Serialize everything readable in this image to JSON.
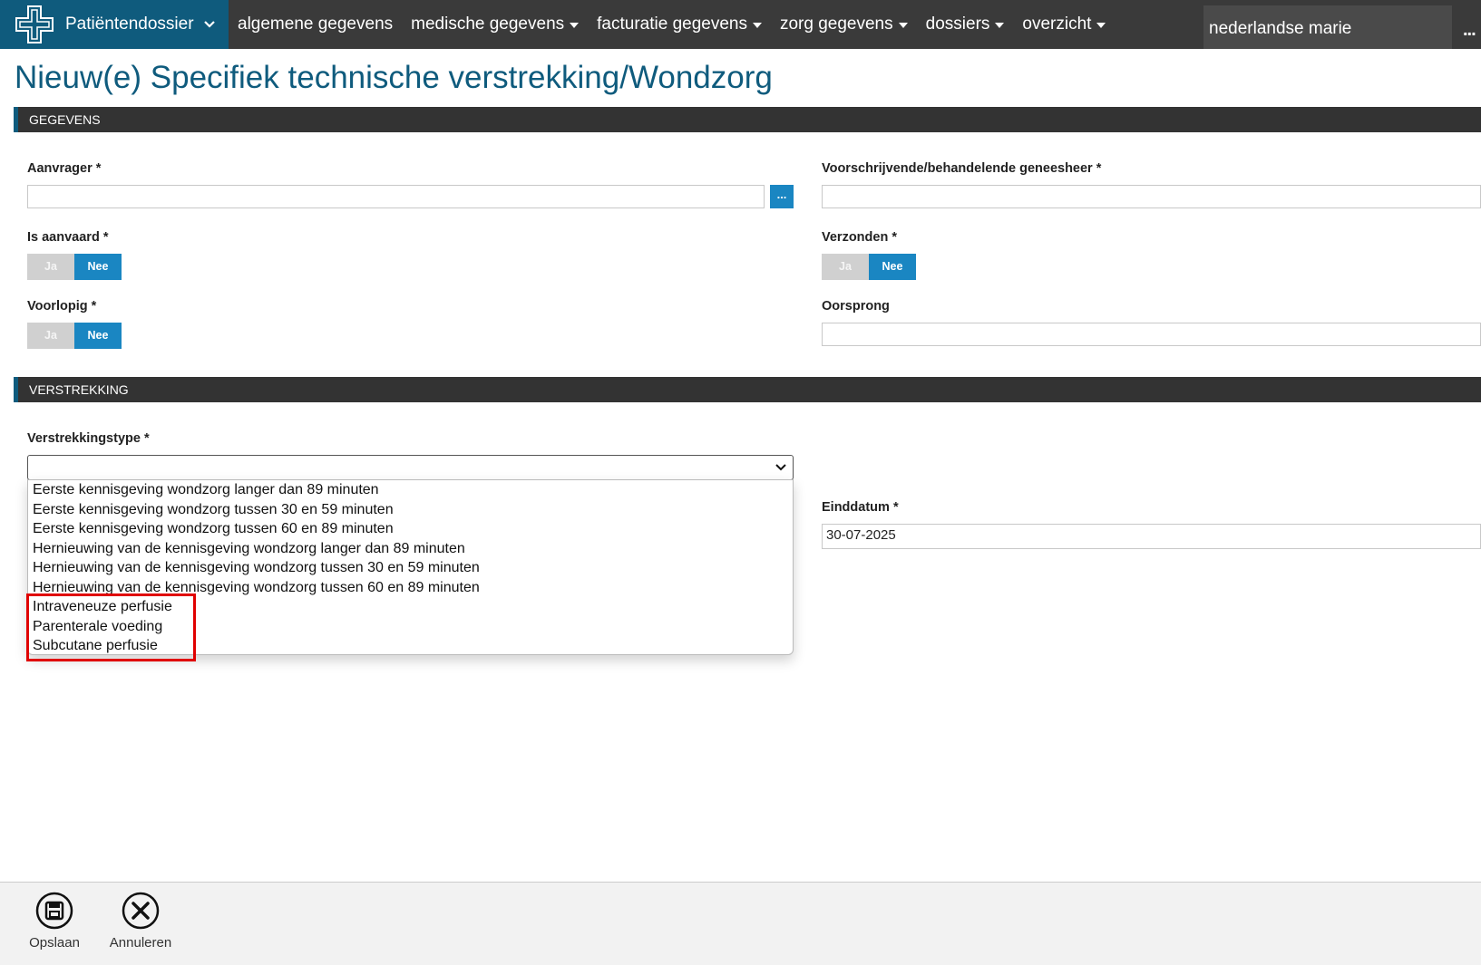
{
  "app": {
    "title": "Patiëntendossier"
  },
  "nav": {
    "items": [
      {
        "label": "algemene gegevens",
        "has_menu": false
      },
      {
        "label": "medische gegevens",
        "has_menu": true
      },
      {
        "label": "facturatie gegevens",
        "has_menu": true
      },
      {
        "label": "zorg gegevens",
        "has_menu": true
      },
      {
        "label": "dossiers",
        "has_menu": true
      },
      {
        "label": "overzicht",
        "has_menu": true
      }
    ],
    "patient_name": "nederlandse marie",
    "more": "..."
  },
  "page": {
    "title": "Nieuw(e) Specifiek technische verstrekking/Wondzorg"
  },
  "sections": {
    "gegevens": "GEGEVENS",
    "verstrekking": "VERSTREKKING"
  },
  "form": {
    "aanvrager": {
      "label": "Aanvrager *",
      "value": "",
      "lookup": "..."
    },
    "geneesheer": {
      "label": "Voorschrijvende/behandelende geneesheer *",
      "value": ""
    },
    "is_aanvaard": {
      "label": "Is aanvaard *",
      "yes": "Ja",
      "no": "Nee",
      "selected": "Nee"
    },
    "verzonden": {
      "label": "Verzonden *",
      "yes": "Ja",
      "no": "Nee",
      "selected": "Nee"
    },
    "voorlopig": {
      "label": "Voorlopig *",
      "yes": "Ja",
      "no": "Nee",
      "selected": "Nee"
    },
    "oorsprong": {
      "label": "Oorsprong",
      "value": ""
    },
    "verstrekkingstype": {
      "label": "Verstrekkingstype *",
      "value": "",
      "options": [
        "Eerste kennisgeving wondzorg langer dan 89 minuten",
        "Eerste kennisgeving wondzorg tussen 30 en 59 minuten",
        "Eerste kennisgeving wondzorg tussen 60 en 89 minuten",
        "Hernieuwing van de kennisgeving wondzorg langer dan 89 minuten",
        "Hernieuwing van de kennisgeving wondzorg tussen 30 en 59 minuten",
        "Hernieuwing van de kennisgeving wondzorg tussen 60 en 89 minuten",
        "Intraveneuze perfusie",
        "Parenterale voeding",
        "Subcutane perfusie"
      ]
    },
    "einddatum": {
      "label": "Einddatum *",
      "value": "30-07-2025"
    }
  },
  "footer": {
    "save": "Opslaan",
    "cancel": "Annuleren"
  },
  "colors": {
    "brand": "#0f5b7d",
    "accent": "#1a86c2",
    "highlight": "#e00000",
    "topbar": "#3a3a3a"
  }
}
